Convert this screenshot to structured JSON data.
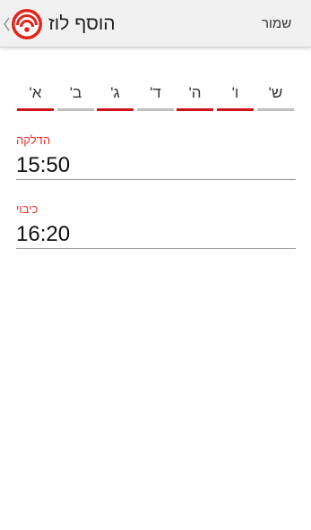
{
  "header": {
    "title": "הוסף לוז",
    "save_label": "שמור",
    "logo_color": "#e2231a"
  },
  "days": [
    {
      "label": "א'",
      "selected": true
    },
    {
      "label": "ב'",
      "selected": false
    },
    {
      "label": "ג'",
      "selected": true
    },
    {
      "label": "ד'",
      "selected": false
    },
    {
      "label": "ה'",
      "selected": true
    },
    {
      "label": "ו'",
      "selected": true
    },
    {
      "label": "ש'",
      "selected": false
    }
  ],
  "colors": {
    "accent": "#d0141e",
    "label": "#e8322f",
    "inactive": "#c0c0c0"
  },
  "fields": {
    "lighting": {
      "label": "הדלקה",
      "value": "15:50"
    },
    "extinguishing": {
      "label": "כיבוי",
      "value": "16:20"
    }
  }
}
